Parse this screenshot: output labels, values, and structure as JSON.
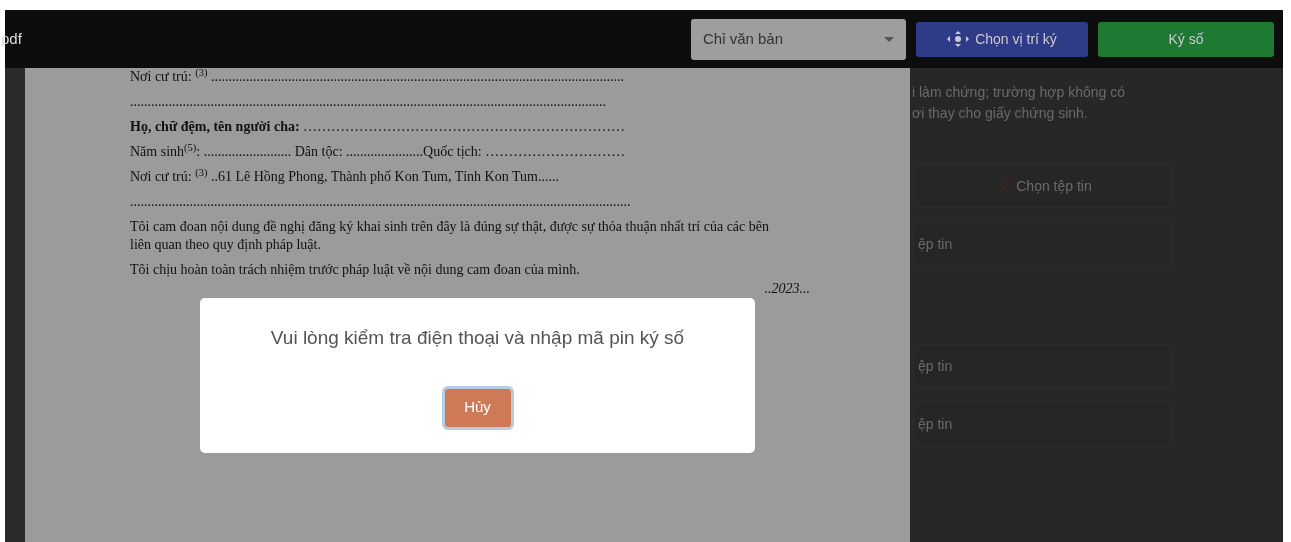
{
  "toolbar": {
    "title": "pdf",
    "select": {
      "value": "Chỉ văn bản"
    },
    "buttons": [
      {
        "kind": "position",
        "label": "Chọn vị trí ký"
      },
      {
        "kind": "sign",
        "label": "Ký số"
      }
    ]
  },
  "document": {
    "lines": [
      {
        "kind": "plain",
        "text": "Nơi cư trú: $^{(3)}$ ......................................................................................................................"
      },
      {
        "kind": "plain",
        "text": "........................................................................................................................................"
      },
      {
        "kind": "plain",
        "text": "**Họ, chữ đệm, tên người cha:** ……………………………………………………………"
      },
      {
        "kind": "plain",
        "text": "Năm sinh$^{(5)}$: ......................... Dân tộc: ......................Quốc tịch: …………………………"
      },
      {
        "kind": "plain",
        "text": "Nơi cư trú: $^{(3)}$ ..61 Lê Hồng Phong, Thành phố Kon Tum, Tỉnh Kon Tum......"
      },
      {
        "kind": "plain",
        "text": "..............................................................................................................................................."
      },
      {
        "kind": "paragraph",
        "text": "Tôi cam đoan nội dung đề nghị đăng ký khai sinh trên đây là đúng sự thật, được sự thỏa thuận nhất trí của các bên liên quan theo quy định pháp luật."
      },
      {
        "kind": "plain",
        "text": "Tôi chịu hoàn toàn trách nhiệm trước pháp luật về nội dung cam đoan của mình."
      },
      {
        "kind": "signature",
        "text": "..2023..."
      }
    ]
  },
  "side_panel": {
    "note_lines": [
      "i làm chứng; trường hợp không có",
      "ơi thay cho giấy chứng sinh."
    ],
    "file_buttons": [
      {
        "kind": "full",
        "label": "Chọn tệp tin"
      },
      {
        "kind": "partial",
        "label": "ệp tin"
      },
      {
        "kind": "partial",
        "label": "ệp tin"
      },
      {
        "kind": "partial",
        "label": "ệp tin"
      }
    ]
  },
  "dialog": {
    "message": "Vui lòng kiểm tra điện thoại và nhập mã pin ký số",
    "cancel_button": "Hủy"
  }
}
